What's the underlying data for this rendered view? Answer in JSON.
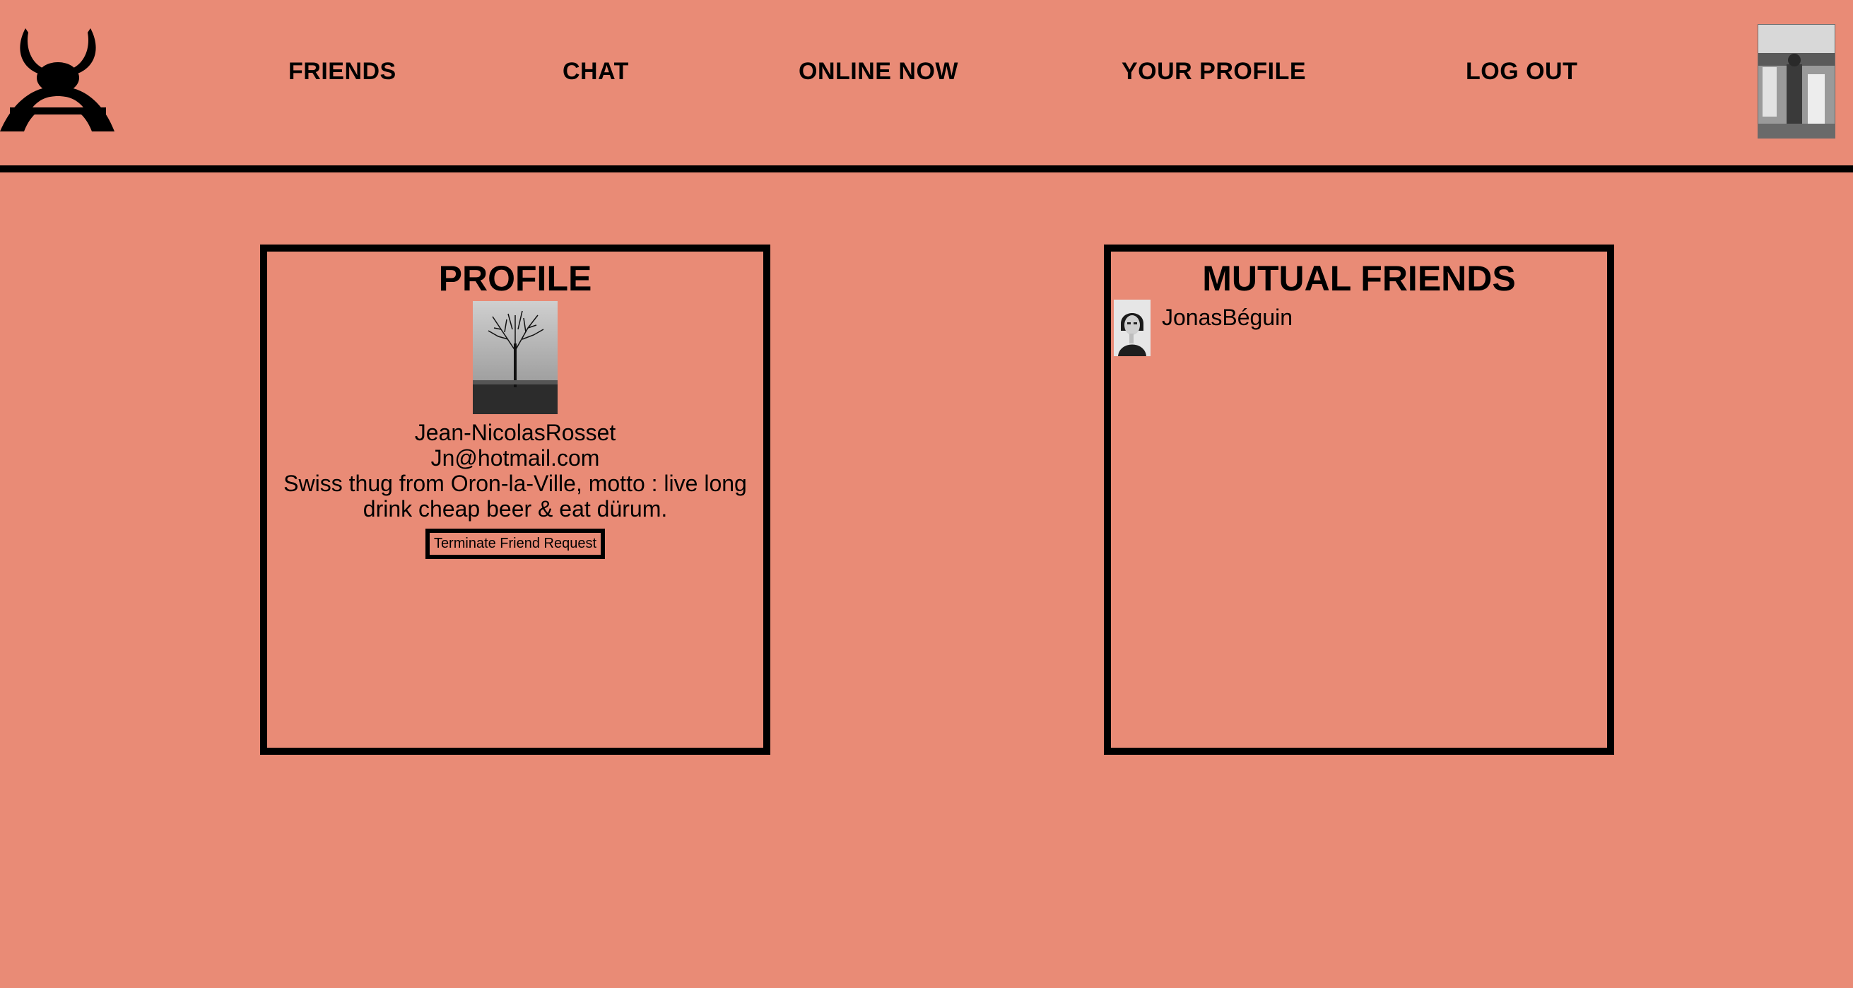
{
  "nav": {
    "friends": "FRIENDS",
    "chat": "CHAT",
    "online_now": "ONLINE NOW",
    "your_profile": "YOUR PROFILE",
    "log_out": "LOG OUT"
  },
  "colors": {
    "background": "#e98b76",
    "foreground": "#000000"
  },
  "profile": {
    "title": "PROFILE",
    "name": "Jean-NicolasRosset",
    "email": "Jn@hotmail.com",
    "bio": "Swiss thug from Oron-la-Ville, motto : live long drink cheap beer & eat dürum.",
    "terminate_label": "Terminate Friend Request"
  },
  "mutual_friends": {
    "title": "MUTUAL FRIENDS",
    "items": [
      {
        "name": "JonasBéguin"
      }
    ]
  }
}
